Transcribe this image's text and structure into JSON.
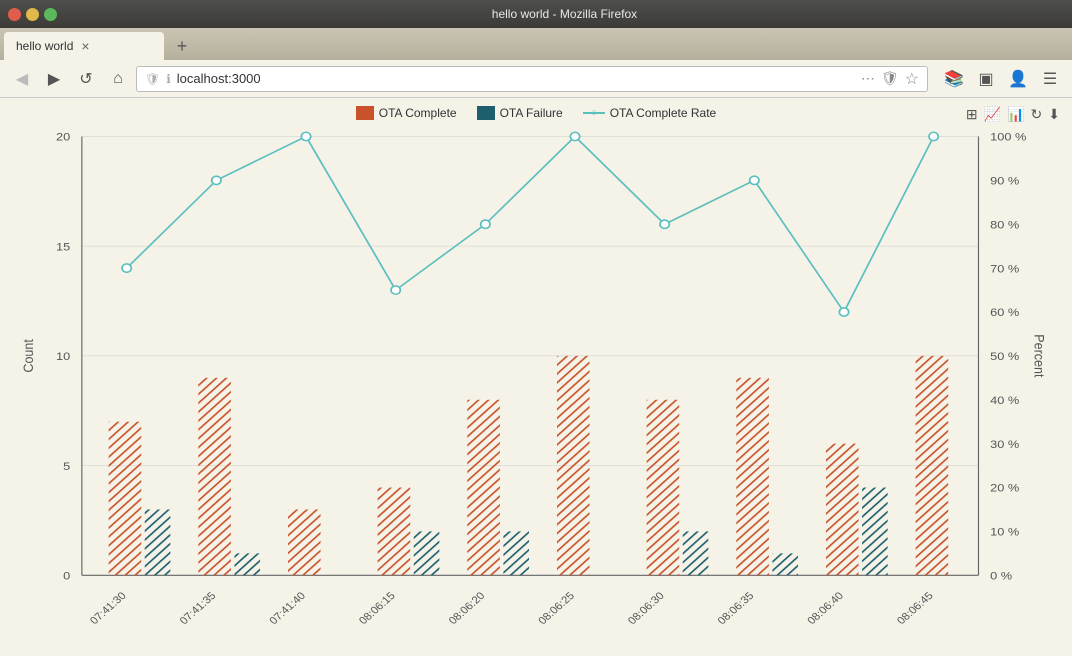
{
  "window": {
    "title": "hello world - Mozilla Firefox",
    "tab_label": "hello world",
    "url": "localhost:3000"
  },
  "buttons": {
    "back": "◀",
    "forward": "▶",
    "reload": "↺",
    "home": "⌂",
    "close_tab": "×",
    "new_tab": "+",
    "menu": "⋯",
    "bookmark": "☆",
    "bookmarks_icon": "📚",
    "sidebar_icon": "▣",
    "profile_icon": "👤",
    "hamburger_icon": "☰"
  },
  "legend": {
    "ota_complete_label": "OTA Complete",
    "ota_failure_label": "OTA Failure",
    "ota_rate_label": "OTA Complete Rate",
    "ota_complete_color": "#c8522a",
    "ota_failure_color": "#1e5f6e",
    "ota_rate_color": "#5abfbf"
  },
  "chart": {
    "left_axis_label": "Count",
    "right_axis_label": "Percent",
    "y_ticks": [
      "0",
      "5",
      "10",
      "15",
      "20"
    ],
    "y_ticks_right": [
      "0 %",
      "10 %",
      "20 %",
      "30 %",
      "40 %",
      "50 %",
      "60 %",
      "70 %",
      "80 %",
      "90 %",
      "100 %"
    ],
    "x_labels": [
      "07:41:30",
      "07:41:35",
      "07:41:40",
      "08:06:15",
      "08:06:20",
      "08:06:25",
      "08:06:30",
      "08:06:35",
      "08:06:40",
      "08:06:45"
    ],
    "bars": [
      {
        "complete": 7,
        "failure": 3
      },
      {
        "complete": 9,
        "failure": 1
      },
      {
        "complete": 3,
        "failure": 0
      },
      {
        "complete": 4,
        "failure": 2
      },
      {
        "complete": 8,
        "failure": 2
      },
      {
        "complete": 10,
        "failure": 0
      },
      {
        "complete": 8,
        "failure": 2
      },
      {
        "complete": 9,
        "failure": 1
      },
      {
        "complete": 6,
        "failure": 4
      },
      {
        "complete": 10,
        "failure": 0
      }
    ],
    "rate_points": [
      70,
      90,
      100,
      65,
      80,
      100,
      80,
      90,
      60,
      100
    ]
  }
}
